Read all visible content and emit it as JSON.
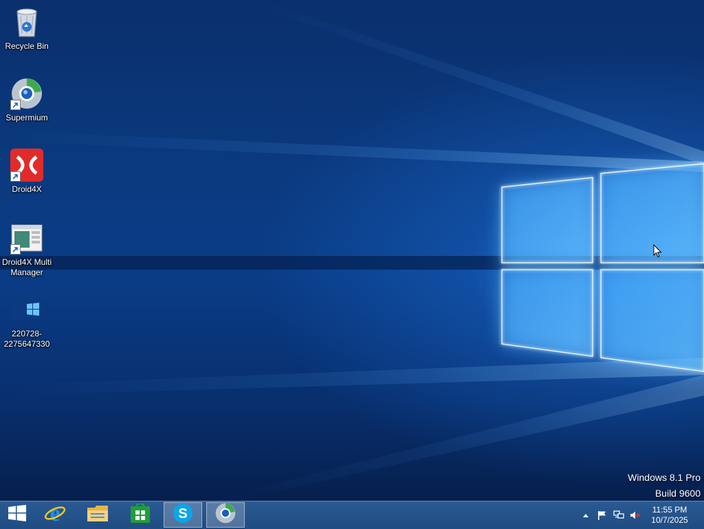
{
  "desktop": {
    "icons": [
      {
        "label": "Recycle Bin",
        "icon": "recycle-bin-icon"
      },
      {
        "label": "Supermium",
        "icon": "supermium-icon"
      },
      {
        "label": "Droid4X",
        "icon": "droid4x-icon"
      },
      {
        "label": "Droid4X Multi Manager",
        "icon": "droid4x-multi-manager-icon"
      },
      {
        "label": "220728-2275647330",
        "icon": "image-file-icon"
      }
    ]
  },
  "watermark": {
    "line1": "Windows 8.1 Pro",
    "line2": "Build 9600"
  },
  "taskbar": {
    "buttons": [
      {
        "name": "start-button",
        "icon": "windows-logo-icon"
      },
      {
        "name": "internet-explorer",
        "icon": "internet-explorer-icon"
      },
      {
        "name": "file-explorer",
        "icon": "folder-icon"
      },
      {
        "name": "windows-store",
        "icon": "store-icon"
      },
      {
        "name": "skype",
        "icon": "skype-icon",
        "active": true
      },
      {
        "name": "supermium",
        "icon": "supermium-icon",
        "active": true
      }
    ],
    "tray": {
      "icons": [
        "chevron-up-icon",
        "flag-icon",
        "network-icon",
        "speaker-muted-icon"
      ],
      "time": "11:55 PM",
      "date": "10/7/2025"
    }
  },
  "colors": {
    "desktop_background": "#0a3a80",
    "taskbar": "#245288",
    "text": "#ffffff"
  }
}
